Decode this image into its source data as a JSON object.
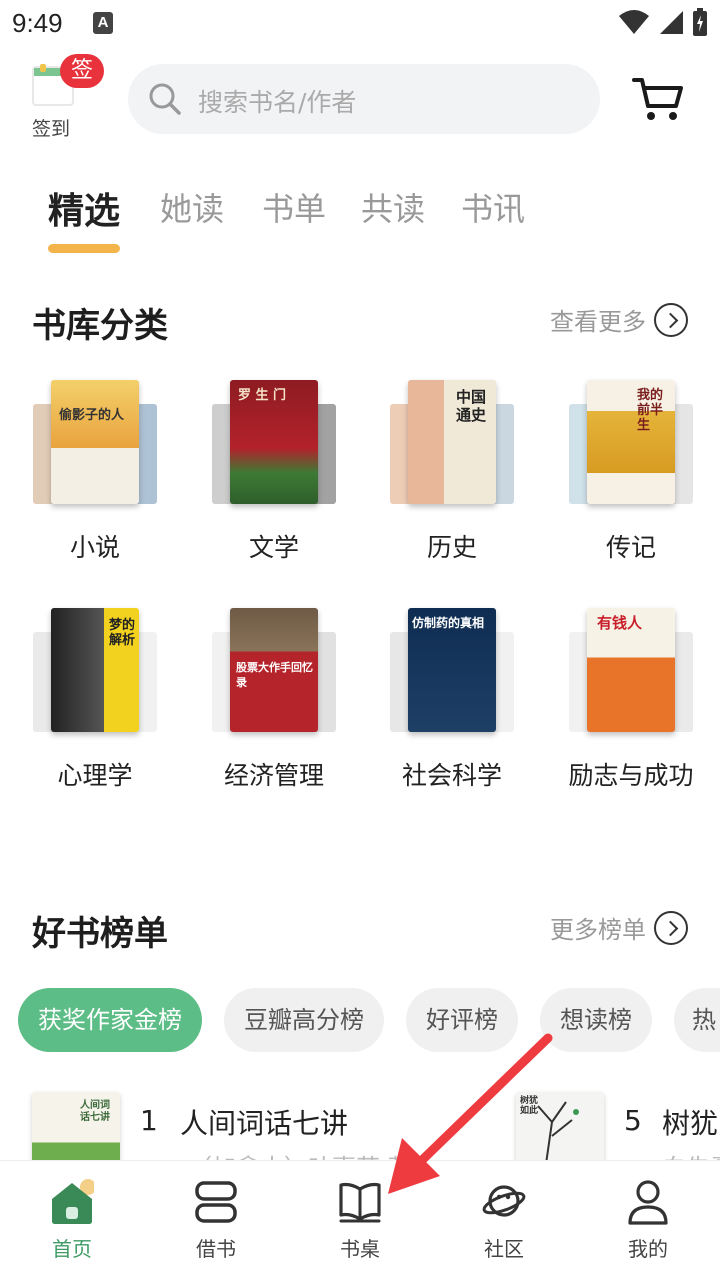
{
  "status_bar": {
    "time": "9:49",
    "a_icon": "A"
  },
  "header": {
    "checkin_badge": "签",
    "checkin_label": "签到",
    "search_placeholder": "搜索书名/作者",
    "cart_icon": "cart-icon"
  },
  "tabs": [
    {
      "label": "精选"
    },
    {
      "label": "她读"
    },
    {
      "label": "书单"
    },
    {
      "label": "共读"
    },
    {
      "label": "书讯"
    }
  ],
  "library": {
    "title": "书库分类",
    "more": "查看更多",
    "categories": [
      {
        "label": "小说",
        "cover_text": "偷影子的人"
      },
      {
        "label": "文学",
        "cover_text": "罗 生 门"
      },
      {
        "label": "历史",
        "cover_text": "中国通史"
      },
      {
        "label": "传记",
        "cover_text": "我的前半生"
      },
      {
        "label": "心理学",
        "cover_text": "梦的解析"
      },
      {
        "label": "经济管理",
        "cover_text": "股票大作手回忆录"
      },
      {
        "label": "社会科学",
        "cover_text": "仿制药的真相"
      },
      {
        "label": "励志与成功",
        "cover_text": "有钱人"
      }
    ]
  },
  "rankings": {
    "title": "好书榜单",
    "more": "更多榜单",
    "chips": [
      {
        "label": "获奖作家金榜"
      },
      {
        "label": "豆瓣高分榜"
      },
      {
        "label": "好评榜"
      },
      {
        "label": "想读榜"
      },
      {
        "label": "热"
      }
    ],
    "items": [
      {
        "rank": "1",
        "title": "人间词话七讲",
        "subtitle": "（加拿大）叶嘉莹 著",
        "cover_text": "人间词话七讲"
      },
      {
        "rank": "5",
        "title": "树犹",
        "subtitle": "白先勇",
        "cover_text": "树犹如此"
      }
    ]
  },
  "bottom_nav": [
    {
      "label": "首页"
    },
    {
      "label": "借书"
    },
    {
      "label": "书桌"
    },
    {
      "label": "社区"
    },
    {
      "label": "我的"
    }
  ],
  "colors": {
    "accent_green": "#5dbd86",
    "tab_underline": "#f3b44c",
    "badge_red": "#e8323c",
    "annotation_arrow": "#ee3b3f"
  }
}
